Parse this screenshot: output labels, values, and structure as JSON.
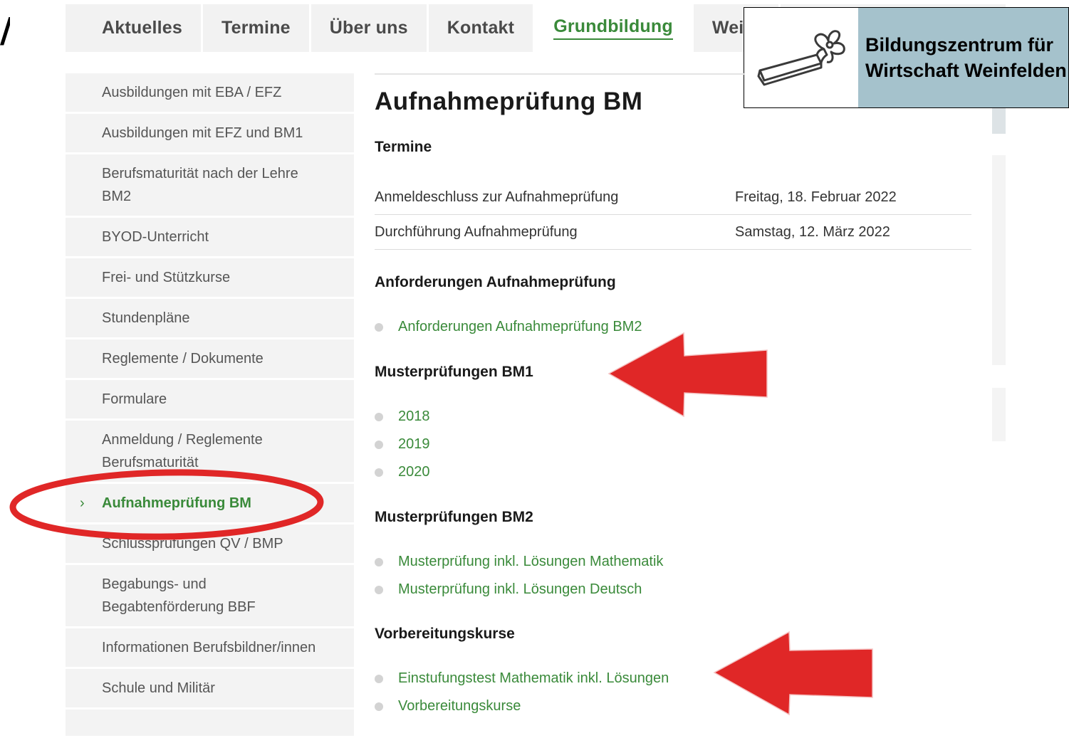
{
  "corner_mark": "/",
  "topnav": {
    "tabs": [
      {
        "label": "Aktuelles"
      },
      {
        "label": "Termine"
      },
      {
        "label": "Über uns"
      },
      {
        "label": "Kontakt"
      },
      {
        "label": "Grundbildung"
      },
      {
        "label": "Weite"
      }
    ],
    "active_tab": "Grundbildung"
  },
  "logo": {
    "line1": "Bildungszentrum für",
    "line2": "Wirtschaft Weinfelden",
    "icon": "logo-mark-icon"
  },
  "sidebar": {
    "items": [
      {
        "label": "Ausbildungen mit EBA / EFZ"
      },
      {
        "label": "Ausbildungen mit EFZ und BM1"
      },
      {
        "label": "Berufsmaturität nach der Lehre BM2"
      },
      {
        "label": "BYOD-Unterricht"
      },
      {
        "label": "Frei- und Stützkurse"
      },
      {
        "label": "Stundenpläne"
      },
      {
        "label": "Reglemente / Dokumente"
      },
      {
        "label": "Formulare"
      },
      {
        "label": "Anmeldung / Reglemente Berufsmaturität"
      },
      {
        "label": "Aufnahmeprüfung BM",
        "active": true
      },
      {
        "label": "Schlussprüfungen QV / BMP"
      },
      {
        "label": "Begabungs- und Begabtenförderung BBF"
      },
      {
        "label": "Informationen Berufsbildner/innen"
      },
      {
        "label": "Schule und Militär"
      }
    ],
    "chevron": "›"
  },
  "main": {
    "title": "Aufnahmeprüfung BM",
    "termine_heading": "Termine",
    "dates": [
      {
        "label": "Anmeldeschluss zur Aufnahmeprüfung",
        "value": "Freitag, 18. Februar 2022"
      },
      {
        "label": "Durchführung Aufnahmeprüfung",
        "value": "Samstag, 12. März 2022"
      }
    ],
    "anforderungen_heading": "Anforderungen Aufnahmeprüfung",
    "anforderungen_links": [
      "Anforderungen Aufnahmeprüfung BM2"
    ],
    "bm1_heading": "Musterprüfungen BM1",
    "bm1_links": [
      "2018",
      "2019",
      "2020"
    ],
    "bm2_heading": "Musterprüfungen BM2",
    "bm2_links": [
      "Musterprüfung inkl. Lösungen Mathematik",
      "Musterprüfung inkl. Lösungen Deutsch"
    ],
    "vorbereitung_heading": "Vorbereitungskurse",
    "vorbereitung_links": [
      "Einstufungstest Mathematik inkl. Lösungen",
      "Vorbereitungskurse"
    ]
  },
  "colors": {
    "accent_green": "#3a8a3a",
    "annotation_red": "#e02727",
    "logo_bg": "#a5c2cc",
    "nav_bg": "#f2f2f2"
  }
}
